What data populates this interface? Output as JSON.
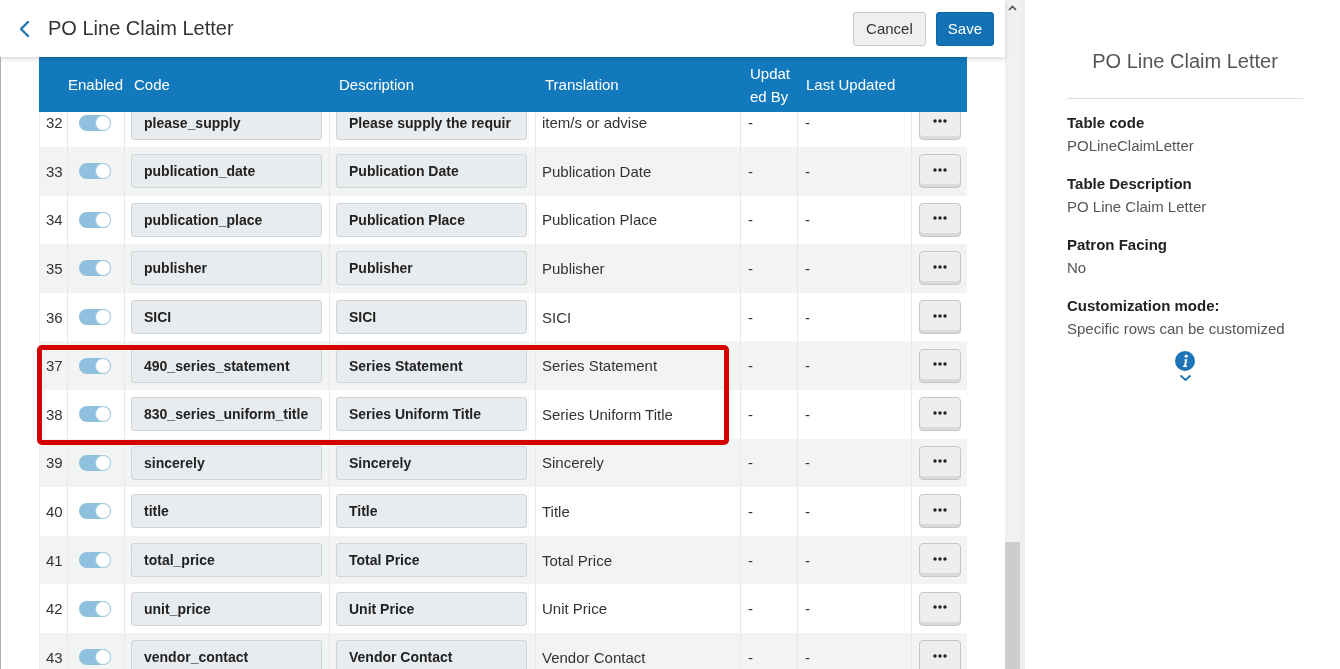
{
  "header": {
    "title": "PO Line Claim Letter",
    "buttons": [
      {
        "label": "Cancel",
        "kind": "secondary"
      },
      {
        "label": "Save",
        "kind": "primary"
      }
    ]
  },
  "table": {
    "columns": [
      "Enabled",
      "Code",
      "Description",
      "Translation",
      "Updated By",
      "Last Updated"
    ],
    "rows": [
      {
        "number": "32",
        "enabled": true,
        "code": "please_supply",
        "description": "Please supply the requir",
        "translation": "item/s or advise",
        "updated_by": "-",
        "last_updated": "-",
        "highlighted": false
      },
      {
        "number": "33",
        "enabled": true,
        "code": "publication_date",
        "description": "Publication Date",
        "translation": "Publication Date",
        "updated_by": "-",
        "last_updated": "-",
        "highlighted": false
      },
      {
        "number": "34",
        "enabled": true,
        "code": "publication_place",
        "description": "Publication Place",
        "translation": "Publication Place",
        "updated_by": "-",
        "last_updated": "-",
        "highlighted": false
      },
      {
        "number": "35",
        "enabled": true,
        "code": "publisher",
        "description": "Publisher",
        "translation": "Publisher",
        "updated_by": "-",
        "last_updated": "-",
        "highlighted": false
      },
      {
        "number": "36",
        "enabled": true,
        "code": "SICI",
        "description": "SICI",
        "translation": "SICI",
        "updated_by": "-",
        "last_updated": "-",
        "highlighted": false
      },
      {
        "number": "37",
        "enabled": true,
        "code": "490_series_statement",
        "description": "Series Statement",
        "translation": "Series Statement",
        "updated_by": "-",
        "last_updated": "-",
        "highlighted": true
      },
      {
        "number": "38",
        "enabled": true,
        "code": "830_series_uniform_title",
        "description": "Series Uniform Title",
        "translation": "Series Uniform Title",
        "updated_by": "-",
        "last_updated": "-",
        "highlighted": true
      },
      {
        "number": "39",
        "enabled": true,
        "code": "sincerely",
        "description": "Sincerely",
        "translation": "Sincerely",
        "updated_by": "-",
        "last_updated": "-",
        "highlighted": false
      },
      {
        "number": "40",
        "enabled": true,
        "code": "title",
        "description": "Title",
        "translation": "Title",
        "updated_by": "-",
        "last_updated": "-",
        "highlighted": false
      },
      {
        "number": "41",
        "enabled": true,
        "code": "total_price",
        "description": "Total Price",
        "translation": "Total Price",
        "updated_by": "-",
        "last_updated": "-",
        "highlighted": false
      },
      {
        "number": "42",
        "enabled": true,
        "code": "unit_price",
        "description": "Unit Price",
        "translation": "Unit Price",
        "updated_by": "-",
        "last_updated": "-",
        "highlighted": false
      },
      {
        "number": "43",
        "enabled": true,
        "code": "vendor_contact",
        "description": "Vendor Contact",
        "translation": "Vendor Contact",
        "updated_by": "-",
        "last_updated": "-",
        "highlighted": false
      }
    ]
  },
  "side_panel": {
    "title": "PO Line Claim Letter",
    "details": [
      {
        "label": "Table code",
        "value": "POLineClaimLetter"
      },
      {
        "label": "Table Description",
        "value": "PO Line Claim Letter"
      },
      {
        "label": "Patron Facing",
        "value": "No"
      },
      {
        "label": "Customization mode:",
        "value": "Specific rows can be customized"
      }
    ]
  }
}
